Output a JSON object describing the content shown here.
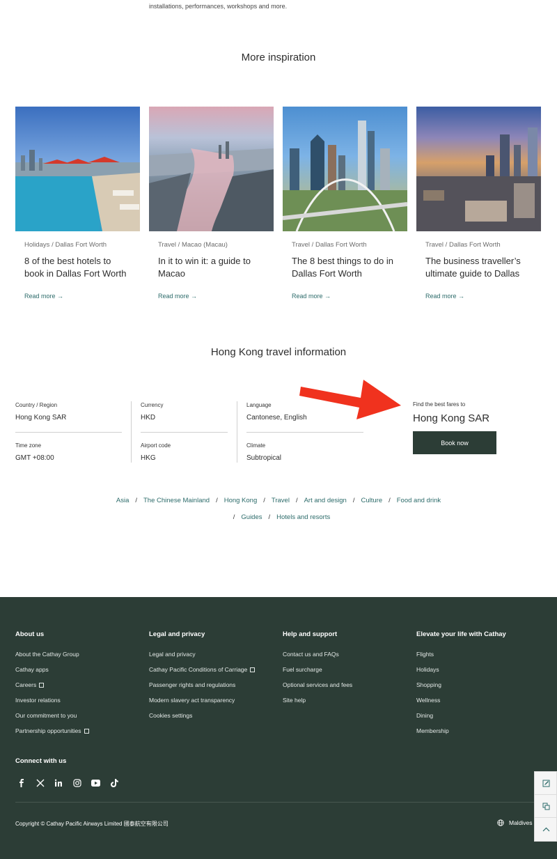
{
  "intro": {
    "text": "installations, performances, workshops and more."
  },
  "inspiration": {
    "title": "More inspiration",
    "cards": [
      {
        "category": "Holidays / Dallas Fort Worth",
        "title": "8 of the best hotels to book in Dallas Fort Worth",
        "link": "Read more →"
      },
      {
        "category": "Travel / Macao (Macau)",
        "title": "In it to win it: a guide to Macao",
        "link": "Read more →"
      },
      {
        "category": "Travel / Dallas Fort Worth",
        "title": "The 8 best things to do in Dallas Fort Worth",
        "link": "Read more →"
      },
      {
        "category": "Travel / Dallas Fort Worth",
        "title": "The business traveller’s ultimate guide to Dallas",
        "link": "Read more →"
      }
    ]
  },
  "travel_info": {
    "title": "Hong Kong travel information",
    "fields": [
      {
        "label": "Country / Region",
        "value": "Hong Kong SAR"
      },
      {
        "label": "Currency",
        "value": "HKD"
      },
      {
        "label": "Language",
        "value": "Cantonese, English"
      },
      {
        "label": "Time zone",
        "value": "GMT +08:00"
      },
      {
        "label": "Airport code",
        "value": "HKG"
      },
      {
        "label": "Climate",
        "value": "Subtropical"
      }
    ],
    "fares_label": "Find the best fares to",
    "fares_destination": "Hong Kong SAR",
    "book_button": "Book now"
  },
  "tags": {
    "row1": [
      "Asia",
      "The Chinese Mainland",
      "Hong Kong",
      "Travel",
      "Art and design",
      "Culture",
      "Food and drink"
    ],
    "row2": [
      "Guides",
      "Hotels and resorts"
    ]
  },
  "footer": {
    "columns": [
      {
        "heading": "About us",
        "items": [
          "About the Cathay Group",
          "Cathay apps",
          "Careers",
          "Investor relations",
          "Our commitment to you",
          "Partnership opportunities"
        ]
      },
      {
        "heading": "Legal and privacy",
        "items": [
          "Legal and privacy",
          "Cathay Pacific Conditions of Carriage",
          "Passenger rights and regulations",
          "Modern slavery act transparency",
          "Cookies settings"
        ]
      },
      {
        "heading": "Help and support",
        "items": [
          "Contact us and FAQs",
          "Fuel surcharge",
          "Optional services and fees",
          "Site help"
        ]
      },
      {
        "heading": "Elevate your life with Cathay",
        "items": [
          "Flights",
          "Holidays",
          "Shopping",
          "Wellness",
          "Dining",
          "Membership"
        ]
      }
    ],
    "connect_heading": "Connect with us",
    "social": [
      "facebook-icon",
      "x-icon",
      "linkedin-icon",
      "instagram-icon",
      "youtube-icon",
      "tiktok-icon"
    ],
    "copyright": "Copyright © Cathay Pacific Airways Limited 國泰航空有限公司",
    "region": "Maldives"
  },
  "colors": {
    "footer_bg": "#2c3d36",
    "link": "#2c6b6a",
    "arrow": "#f0321e"
  }
}
